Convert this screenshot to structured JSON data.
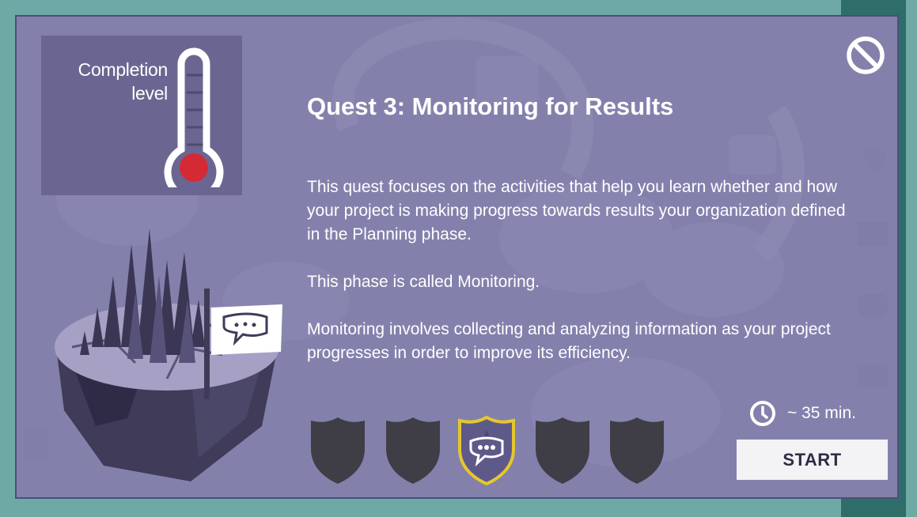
{
  "completion": {
    "label_line1": "Completion",
    "label_line2": "level",
    "thermometer_bulb_color": "#d42a36"
  },
  "quest": {
    "title": "Quest 3: Monitoring for Results",
    "paragraphs": [
      "This quest focuses on the activities that help you learn whether and how your project is making progress towards results your organization defined in the Planning phase.",
      "This phase is called Monitoring.",
      "Monitoring involves collecting and analyzing information as your project progresses in order to improve its efficiency."
    ]
  },
  "duration": {
    "text": "~ 35 min.",
    "icon": "clock-icon"
  },
  "start_button": {
    "label": "START"
  },
  "badges": [
    {
      "state": "locked",
      "icon": "shield-icon"
    },
    {
      "state": "locked",
      "icon": "shield-icon"
    },
    {
      "state": "active",
      "icon": "chat-bubble-icon",
      "accent": "#e6c72d"
    },
    {
      "state": "locked",
      "icon": "shield-icon"
    },
    {
      "state": "locked",
      "icon": "shield-icon"
    }
  ],
  "colors": {
    "overlay": "#8381ac",
    "badge_locked": "#3f3e46",
    "badge_active_fill": "#5d5a8a",
    "badge_active_border": "#e6c72d",
    "start_text": "#2e2b45"
  }
}
